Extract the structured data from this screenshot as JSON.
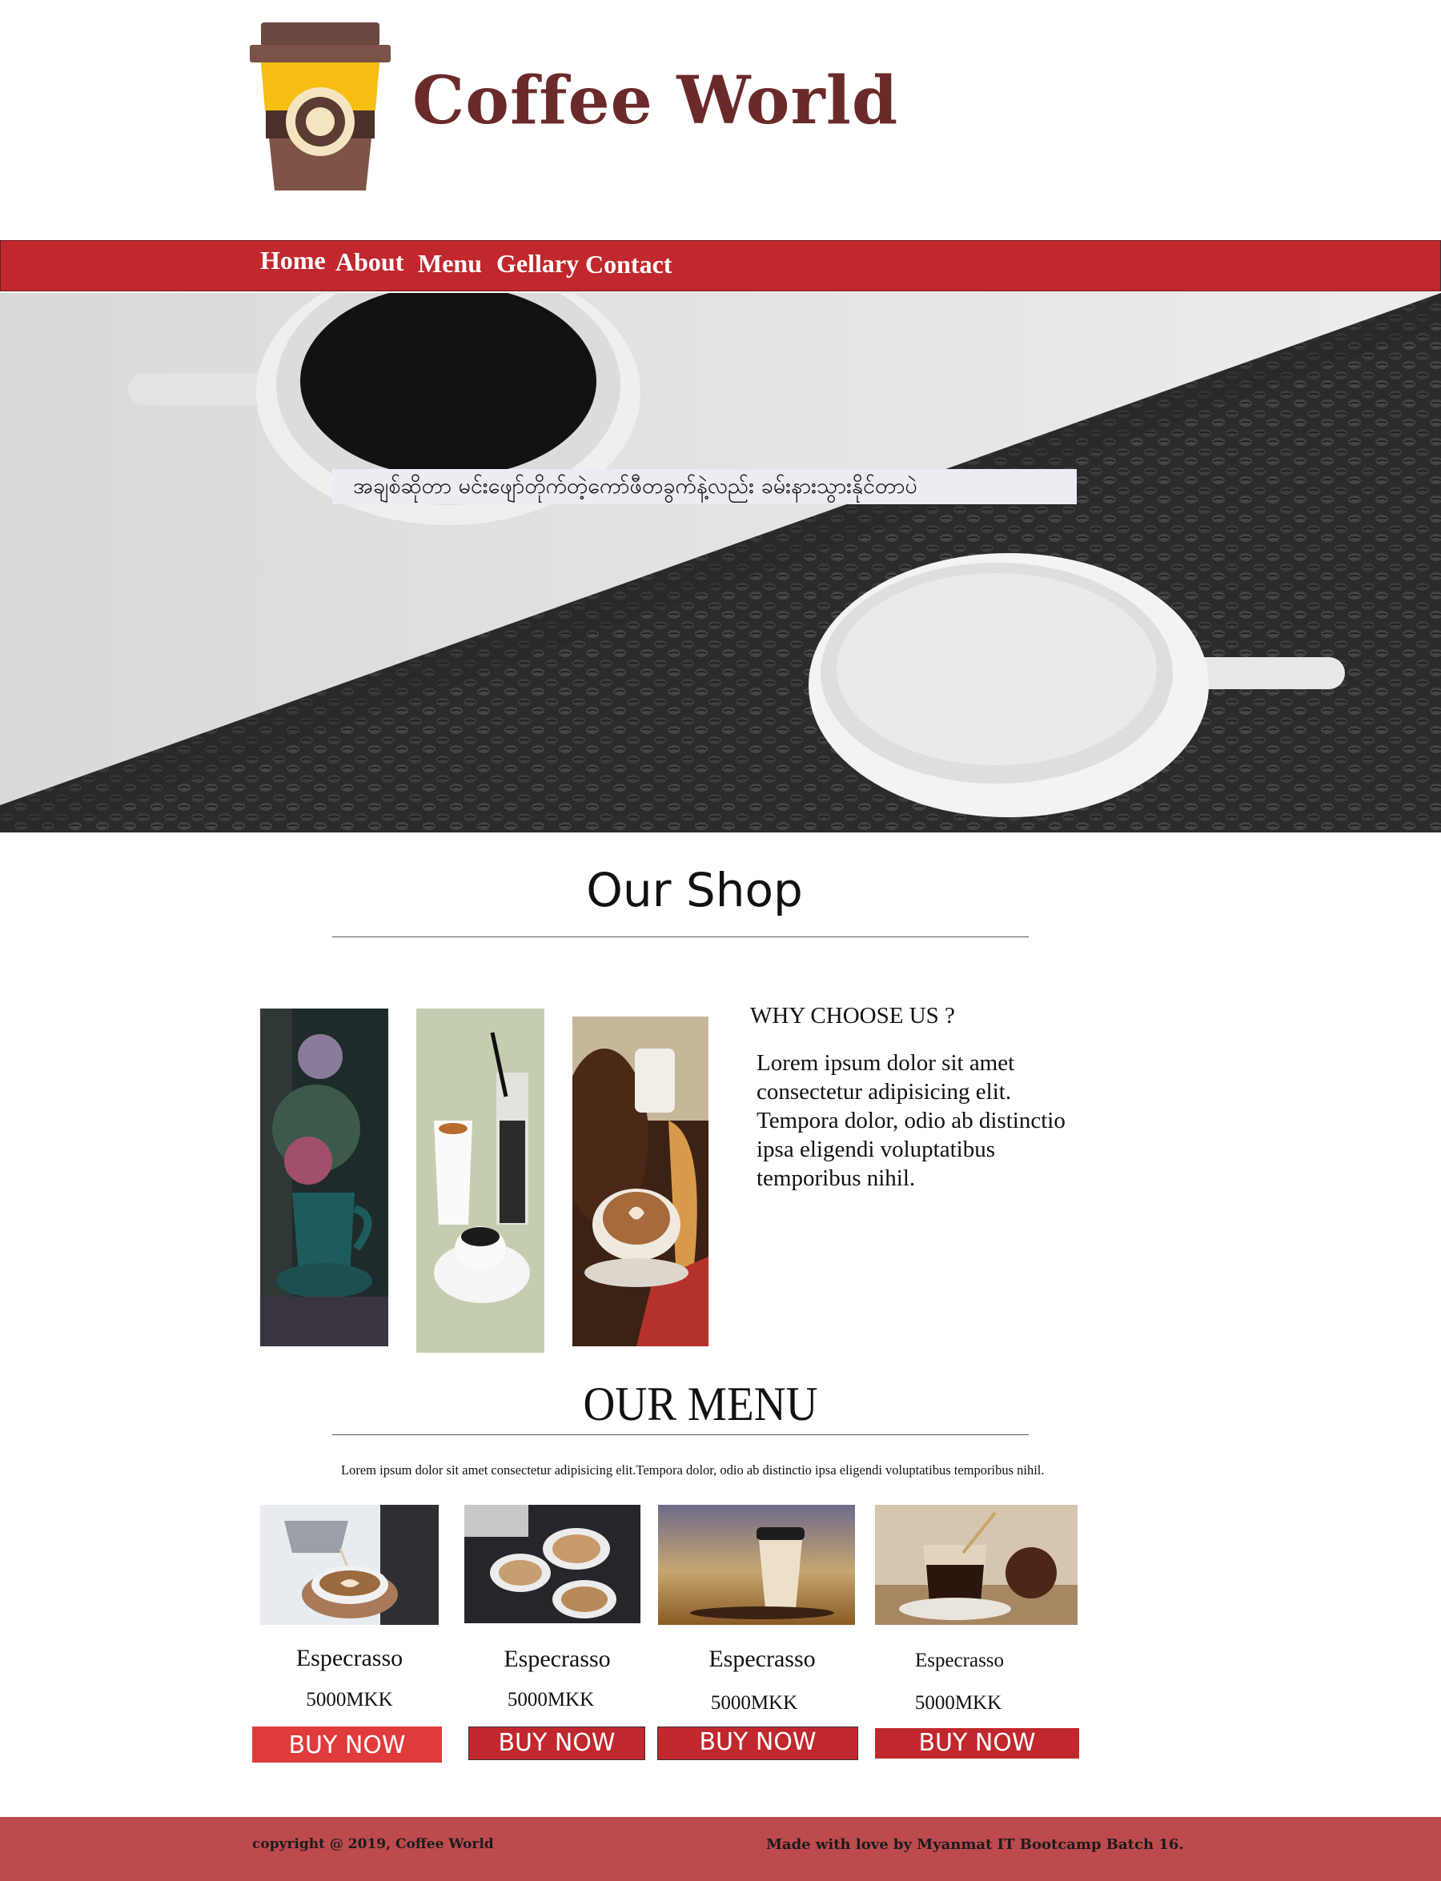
{
  "brand": {
    "name": "Coffee World"
  },
  "nav": {
    "items": [
      {
        "label": "Home"
      },
      {
        "label": "About"
      },
      {
        "label": "Menu"
      },
      {
        "label": "Gellary"
      },
      {
        "label": "Contact"
      }
    ]
  },
  "hero": {
    "tagline": "အချစ်ဆိုတာ မင်းဖျော်တိုက်တဲ့ကော်ဖီတခွက်နဲ့လည်း ခမ်းနားသွားနိုင်တာပဲ"
  },
  "shop": {
    "title": "Our Shop",
    "why_heading": "WHY CHOOSE US ?",
    "why_text": "Lorem ipsum dolor sit amet consectetur adipisicing elit. Tempora dolor, odio ab distinctio ipsa eligendi voluptatibus temporibus nihil."
  },
  "menu": {
    "title": "OUR MENU",
    "description": "Lorem ipsum dolor sit amet consectetur adipisicing elit.Tempora dolor, odio ab distinctio ipsa eligendi voluptatibus temporibus nihil.",
    "items": [
      {
        "name": "Especrasso",
        "price": "5000MKK",
        "button": "BUY NOW"
      },
      {
        "name": "Especrasso",
        "price": "5000MKK",
        "button": "BUY NOW"
      },
      {
        "name": "Especrasso",
        "price": "5000MKK",
        "button": "BUY NOW"
      },
      {
        "name": "Especrasso",
        "price": "5000MKK",
        "button": "BUY NOW"
      }
    ]
  },
  "footer": {
    "copyright": "copyright @ 2019, Coffee World",
    "credit": "Made with love by Myanmat IT Bootcamp Batch 16."
  },
  "colors": {
    "nav_red": "#c1282d",
    "brand_brown": "#6b2a2a",
    "footer_red": "#bd4a4d",
    "button_red": "#c1282d"
  }
}
